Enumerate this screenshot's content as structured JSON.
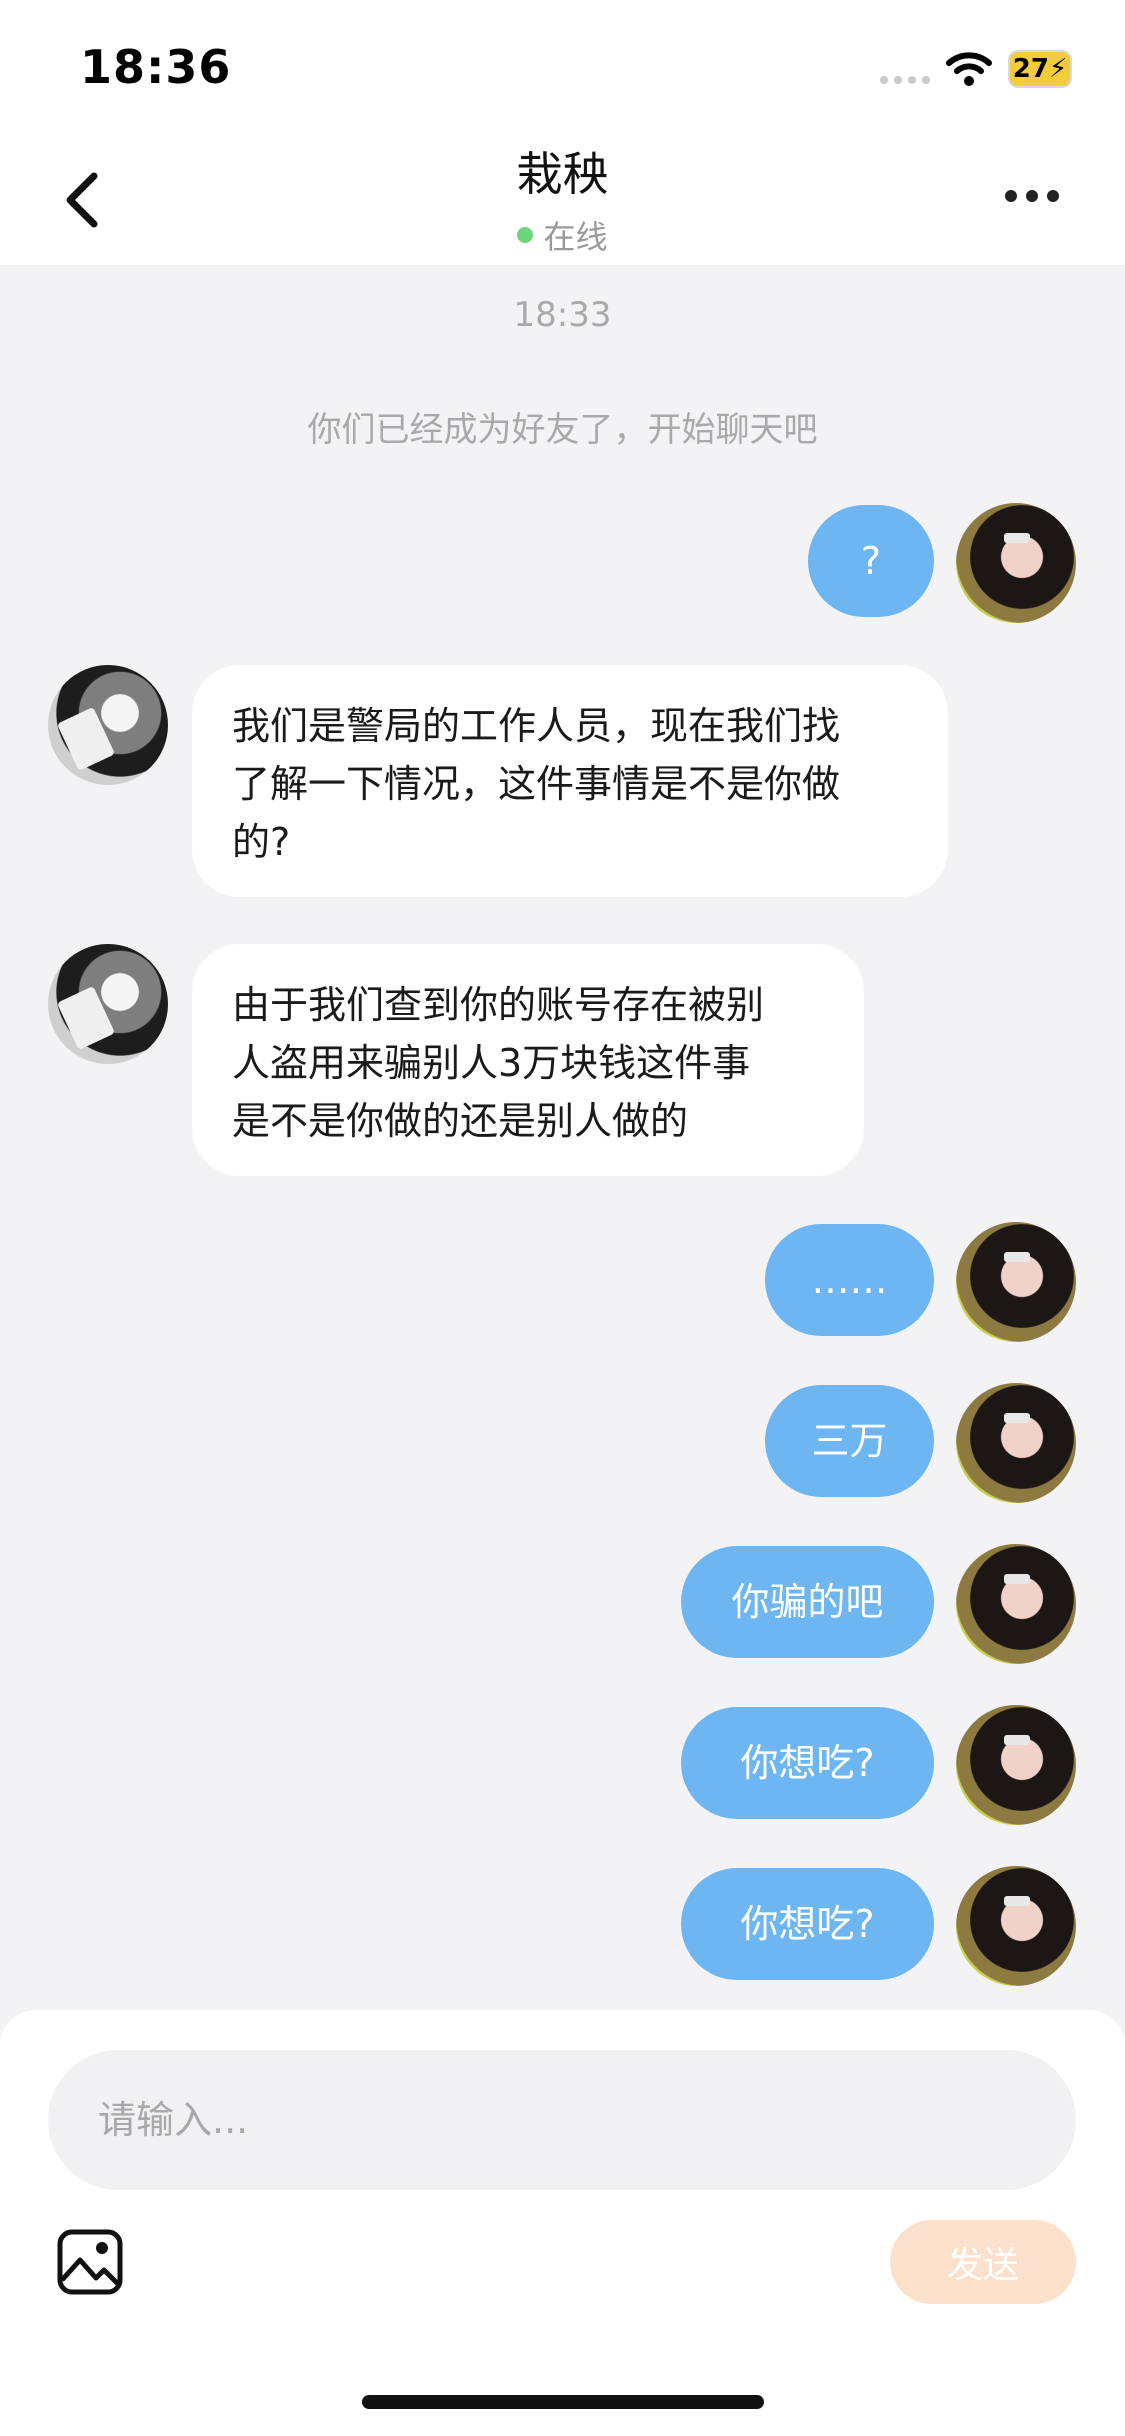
{
  "status_bar": {
    "time": "18:36",
    "battery": "27"
  },
  "header": {
    "back_icon": "chevron-left-icon",
    "title": "栽秧",
    "presence": "在线",
    "more_icon": "more-horizontal-icon"
  },
  "chat": {
    "timestamp": "18:33",
    "system_note": "你们已经成为好友了，开始聊天吧",
    "messages": [
      {
        "side": "out",
        "text": "?"
      },
      {
        "side": "in",
        "lines": [
          "我们是警局的工作人员，现在我们找",
          "了解一下情况，这件事情是不是你做",
          "的?"
        ]
      },
      {
        "side": "in",
        "lines": [
          "由于我们查到你的账号存在被别",
          "人盗用来骗别人3万块钱这件事",
          "是不是你做的还是别人做的"
        ]
      },
      {
        "side": "out",
        "text": "……"
      },
      {
        "side": "out",
        "text": "三万"
      },
      {
        "side": "out",
        "text": "你骗的吧"
      },
      {
        "side": "out",
        "text": "你想吃?"
      },
      {
        "side": "out",
        "text": "你想吃?"
      }
    ]
  },
  "composer": {
    "placeholder": "请输入...",
    "image_icon": "image-icon",
    "send_label": "发送"
  },
  "colors": {
    "outgoing_bubble": "#6db6f2",
    "incoming_bubble": "#ffffff",
    "send_button_disabled": "#fbe0cc",
    "online": "#6ed67a"
  }
}
